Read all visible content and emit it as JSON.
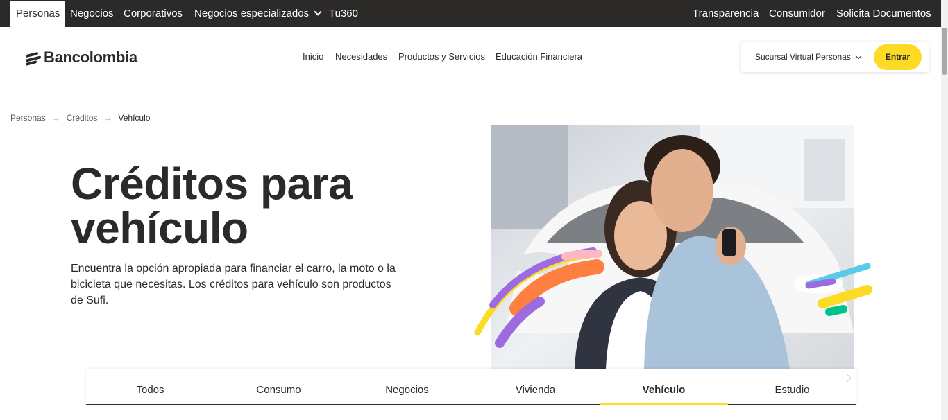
{
  "top_nav": {
    "items": [
      {
        "label": "Personas",
        "active": true
      },
      {
        "label": "Negocios"
      },
      {
        "label": "Corporativos"
      },
      {
        "label": "Negocios especializados",
        "has_dropdown": true
      },
      {
        "label": "Tu360"
      }
    ],
    "right_items": [
      {
        "label": "Transparencia"
      },
      {
        "label": "Consumidor"
      },
      {
        "label": "Solicita Documentos"
      }
    ]
  },
  "header": {
    "logo_text": "Bancolombia",
    "nav": [
      {
        "label": "Inicio"
      },
      {
        "label": "Necesidades"
      },
      {
        "label": "Productos y Servicios"
      },
      {
        "label": "Educación Financiera"
      }
    ],
    "sucursal_label": "Sucursal Virtual Personas",
    "entrar_label": "Entrar"
  },
  "breadcrumb": {
    "items": [
      "Personas",
      "Créditos",
      "Vehículo"
    ]
  },
  "hero": {
    "title": "Créditos para vehículo",
    "description": "Encuentra la opción apropiada para financiar el carro, la moto o la bicicleta que necesitas. Los créditos para vehículo son productos de Sufi."
  },
  "tabs": {
    "items": [
      {
        "label": "Todos"
      },
      {
        "label": "Consumo"
      },
      {
        "label": "Negocios"
      },
      {
        "label": "Vivienda"
      },
      {
        "label": "Vehículo",
        "active": true
      },
      {
        "label": "Estudio"
      }
    ]
  },
  "colors": {
    "brand_yellow": "#fdda24",
    "dark": "#2c2a29",
    "decor_purple": "#9c6bdf",
    "decor_orange": "#ff7f41",
    "decor_pink": "#ffb7c5",
    "decor_cyan": "#59cbe8",
    "decor_green": "#00c389"
  },
  "icons": {
    "dropdown": "chevron-down-icon",
    "breadcrumb_separator": "arrow-right-icon",
    "tabs_next": "chevron-right-icon"
  }
}
